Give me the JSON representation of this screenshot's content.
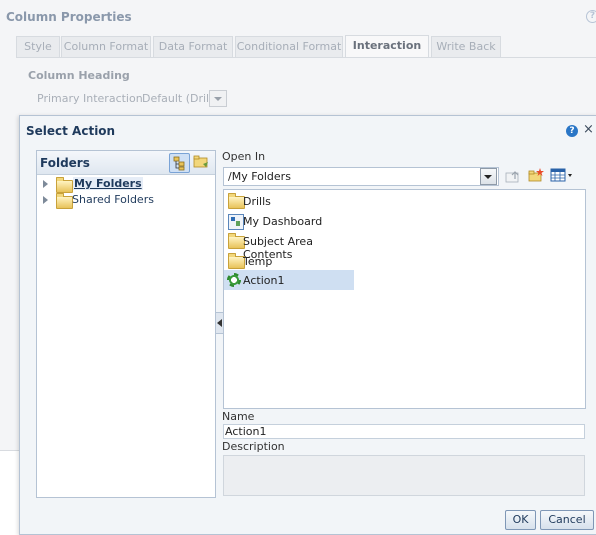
{
  "background_dialog": {
    "title": "Column Properties",
    "help_glyph": "?",
    "tabs": [
      {
        "label": "Style"
      },
      {
        "label": "Column Format"
      },
      {
        "label": "Data Format"
      },
      {
        "label": "Conditional Format"
      },
      {
        "label": "Interaction",
        "active": true
      },
      {
        "label": "Write Back"
      }
    ],
    "section_heading": "Column Heading",
    "primary_interaction": {
      "label": "Primary Interaction",
      "value": "Default (Drill)"
    }
  },
  "select_action": {
    "title": "Select Action",
    "help_glyph": "?",
    "close_glyph": "×",
    "folders_panel": {
      "title": "Folders",
      "tree": [
        {
          "label": "My Folders",
          "selected": true
        },
        {
          "label": "Shared Folders",
          "selected": false
        }
      ]
    },
    "open_in": {
      "label": "Open In",
      "value": "/My Folders"
    },
    "items": [
      {
        "label": "Drills",
        "icon": "folder-icon"
      },
      {
        "label": "My Dashboard",
        "icon": "dashboard-icon"
      },
      {
        "label": "Subject Area Contents",
        "icon": "folder-icon"
      },
      {
        "label": "Temp",
        "icon": "folder-icon"
      },
      {
        "label": "Action1",
        "icon": "action-gear-icon",
        "selected": true
      }
    ],
    "name": {
      "label": "Name",
      "value": "Action1"
    },
    "description": {
      "label": "Description",
      "value": ""
    },
    "buttons": {
      "ok": "OK",
      "cancel": "Cancel"
    }
  },
  "colors": {
    "accent": "#1f3a5c",
    "selection": "#cfdff2",
    "border": "#b5c3d4"
  }
}
